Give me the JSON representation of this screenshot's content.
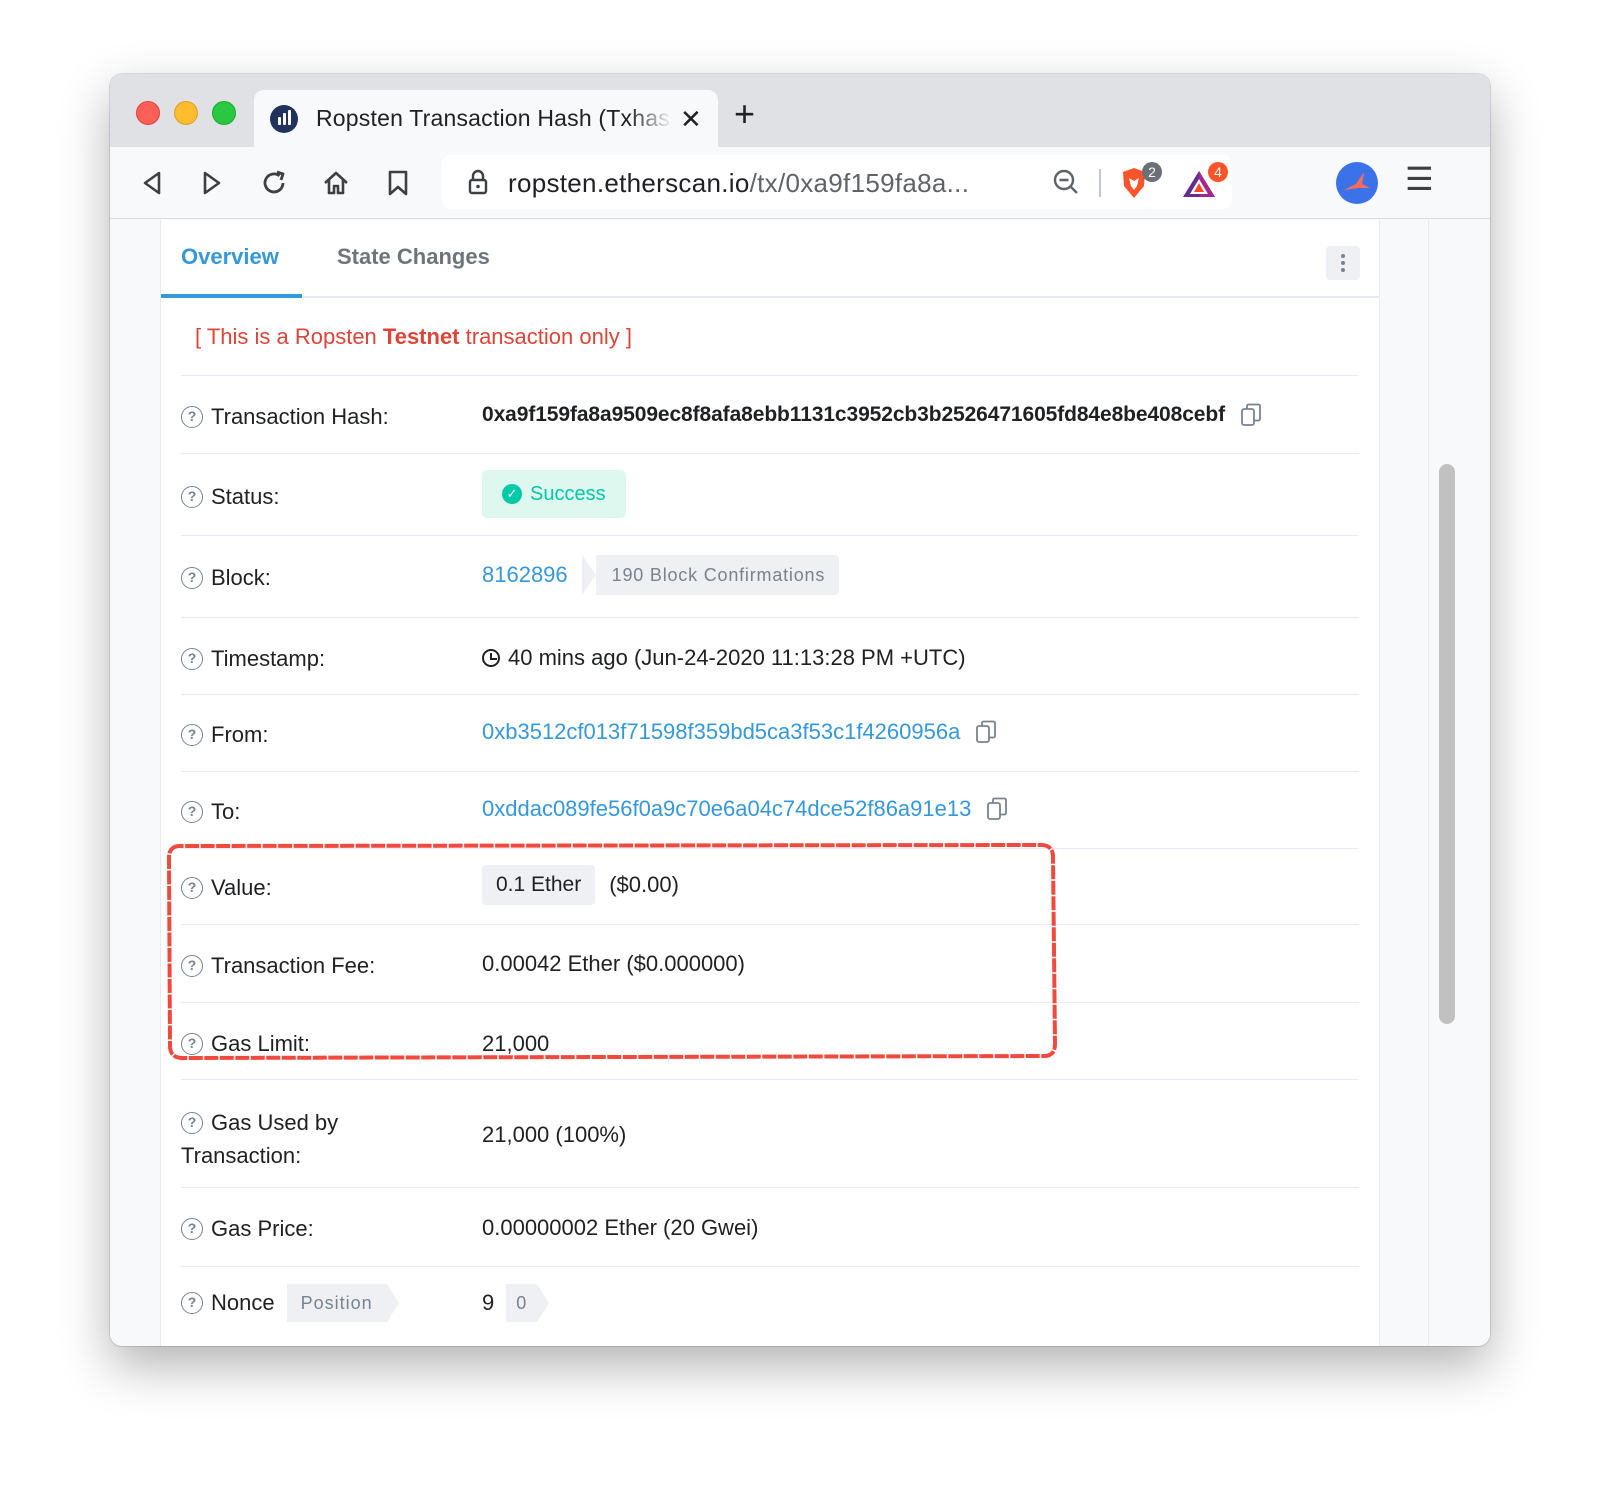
{
  "browser": {
    "tab_title": "Ropsten Transaction Hash (Txhash) Details",
    "tab_close": "✕",
    "new_tab": "+",
    "url_host": "ropsten.etherscan.io",
    "url_path": "/tx/0xa9f159fa8a...",
    "shields_badge": "2",
    "rewards_badge": "4",
    "menu": "☰"
  },
  "page": {
    "tabs": [
      "Overview",
      "State Changes"
    ],
    "notice": {
      "before": "[ This is a Ropsten ",
      "bold": "Testnet",
      "after": " transaction only ]"
    },
    "labels": {
      "tx_hash": "Transaction Hash:",
      "status": "Status:",
      "block": "Block:",
      "timestamp": "Timestamp:",
      "from": "From:",
      "to": "To:",
      "value": "Value:",
      "fee": "Transaction Fee:",
      "gas_limit": "Gas Limit:",
      "gas_used_1": "Gas Used by",
      "gas_used_2": "Transaction:",
      "gas_price": "Gas Price:",
      "nonce": "Nonce",
      "position": "Position"
    },
    "values": {
      "tx_hash": "0xa9f159fa8a9509ec8f8afa8ebb1131c3952cb3b2526471605fd84e8be408cebf",
      "status": "Success",
      "block": "8162896",
      "confirmations": "190 Block Confirmations",
      "timestamp": "40 mins ago (Jun-24-2020 11:13:28 PM +UTC)",
      "from": "0xb3512cf013f71598f359bd5ca3f53c1f4260956a",
      "to": "0xddac089fe56f0a9c70e6a04c74dce52f86a91e13",
      "value_ether": "0.1 Ether",
      "value_usd": "($0.00)",
      "fee": "0.00042 Ether ($0.000000)",
      "gas_limit": "21,000",
      "gas_used": "21,000 (100%)",
      "gas_price": "0.00000002 Ether (20 Gwei)",
      "nonce": "9",
      "position": "0"
    },
    "question_mark": "?"
  },
  "colors": {
    "link": "#3498db",
    "success": "#00c9a7",
    "notice_red": "#de4437",
    "highlight_red": "#f04a3e"
  }
}
